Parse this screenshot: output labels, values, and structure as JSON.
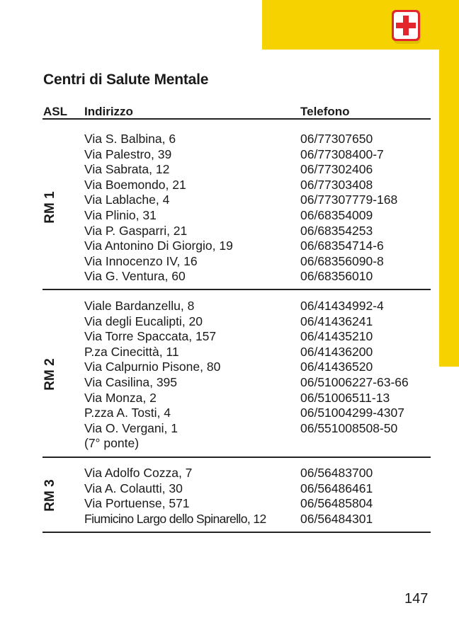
{
  "page_title": "Centri di Salute Mentale",
  "columns": {
    "asl": "ASL",
    "address": "Indirizzo",
    "phone": "Telefono"
  },
  "groups": [
    {
      "asl": "RM 1",
      "rows": [
        {
          "address": "Via S. Balbina, 6",
          "phone": "06/77307650"
        },
        {
          "address": "Via Palestro, 39",
          "phone": "06/77308400-7"
        },
        {
          "address": "Via Sabrata, 12",
          "phone": "06/77302406"
        },
        {
          "address": "Via Boemondo, 21",
          "phone": "06/77303408"
        },
        {
          "address": "Via Lablache, 4",
          "phone": "06/77307779-168"
        },
        {
          "address": "Via Plinio, 31",
          "phone": "06/68354009"
        },
        {
          "address": "Via P. Gasparri, 21",
          "phone": "06/68354253"
        },
        {
          "address": "Via Antonino Di Giorgio, 19",
          "phone": "06/68354714-6"
        },
        {
          "address": "Via Innocenzo IV, 16",
          "phone": "06/68356090-8"
        },
        {
          "address": "Via G. Ventura, 60",
          "phone": "06/68356010"
        }
      ]
    },
    {
      "asl": "RM 2",
      "rows": [
        {
          "address": "Viale Bardanzellu, 8",
          "phone": "06/41434992-4"
        },
        {
          "address": "Via degli Eucalipti, 20",
          "phone": "06/41436241"
        },
        {
          "address": "Via Torre Spaccata, 157",
          "phone": "06/41435210"
        },
        {
          "address": "P.za Cinecittà, 11",
          "phone": "06/41436200"
        },
        {
          "address": "Via Calpurnio Pisone, 80",
          "phone": "06/41436520"
        },
        {
          "address": "Via Casilina, 395",
          "phone": "06/51006227-63-66"
        },
        {
          "address": "Via Monza, 2",
          "phone": "06/51006511-13"
        },
        {
          "address": "P.zza A. Tosti, 4",
          "phone": "06/51004299-4307"
        },
        {
          "address": "Via O. Vergani, 1",
          "phone": "06/551008508-50"
        },
        {
          "address": "(7° ponte)",
          "phone": ""
        }
      ]
    },
    {
      "asl": "RM 3",
      "rows": [
        {
          "address": "Via Adolfo Cozza, 7",
          "phone": "06/56483700"
        },
        {
          "address": "Via A. Colautti, 30",
          "phone": "06/56486461"
        },
        {
          "address": "Via Portuense, 571",
          "phone": "06/56485804"
        },
        {
          "address": "Fiumicino Largo dello Spinarello, 12",
          "phone": "06/56484301"
        }
      ]
    }
  ],
  "page_number": "147",
  "icon": "first-aid-kit-icon",
  "colors": {
    "tab": "#f5d200",
    "cross": "#e3262b"
  }
}
